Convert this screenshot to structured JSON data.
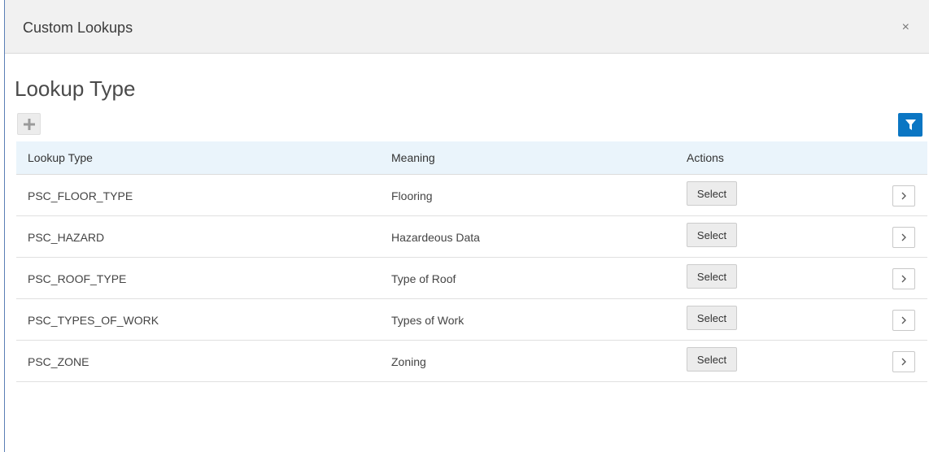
{
  "dialog": {
    "title": "Custom Lookups",
    "close_icon": "close-icon",
    "close_symbol": "×"
  },
  "section": {
    "title": "Lookup Type",
    "add_icon": "plus-icon",
    "filter_icon": "filter-icon"
  },
  "colors": {
    "accent": "#0b76c3",
    "header_bg": "#f1f1f1",
    "table_header_bg": "#eaf4fb"
  },
  "table": {
    "columns": [
      "Lookup Type",
      "Meaning",
      "Actions"
    ],
    "select_label": "Select",
    "row_action_icon": "chevron-right-icon",
    "rows": [
      {
        "lookup_type": "PSC_FLOOR_TYPE",
        "meaning": "Flooring"
      },
      {
        "lookup_type": "PSC_HAZARD",
        "meaning": "Hazardeous Data"
      },
      {
        "lookup_type": "PSC_ROOF_TYPE",
        "meaning": "Type of Roof"
      },
      {
        "lookup_type": "PSC_TYPES_OF_WORK",
        "meaning": "Types of Work"
      },
      {
        "lookup_type": "PSC_ZONE",
        "meaning": "Zoning"
      }
    ]
  }
}
